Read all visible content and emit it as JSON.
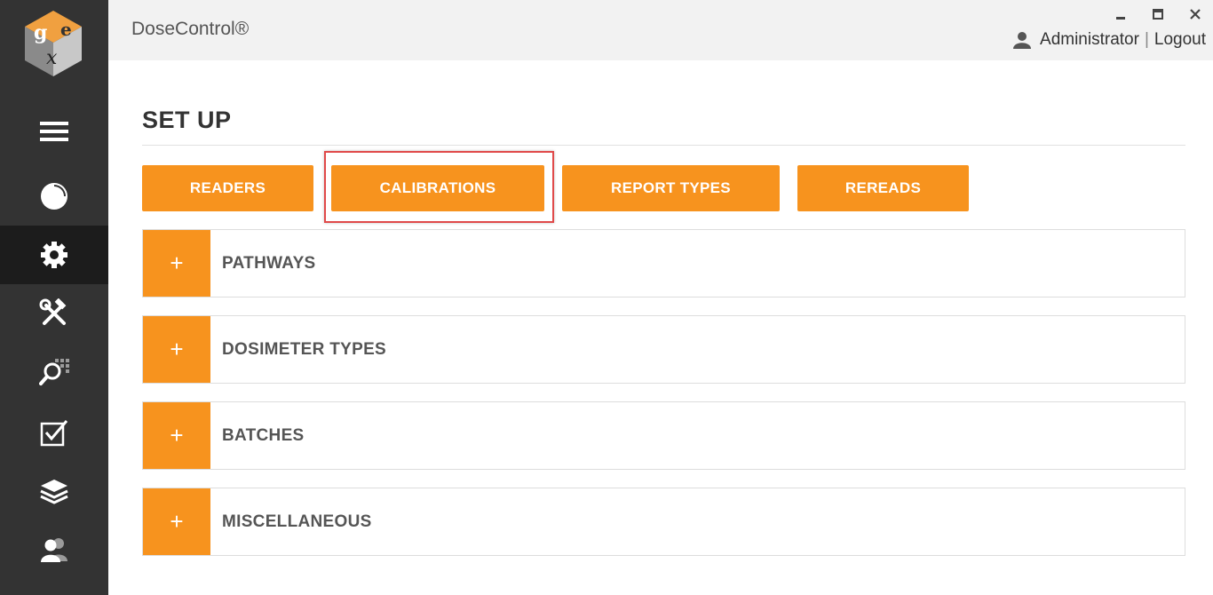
{
  "app": {
    "title": "DoseControl®"
  },
  "user": {
    "name": "Administrator",
    "separator": "|",
    "logout_label": "Logout"
  },
  "page": {
    "title": "SET UP"
  },
  "tabs": [
    {
      "label": "READERS"
    },
    {
      "label": "CALIBRATIONS",
      "highlighted": true
    },
    {
      "label": "REPORT TYPES"
    },
    {
      "label": "REREADS"
    }
  ],
  "panels": [
    {
      "toggle": "+",
      "label": "PATHWAYS"
    },
    {
      "toggle": "+",
      "label": "DOSIMETER TYPES"
    },
    {
      "toggle": "+",
      "label": "BATCHES"
    },
    {
      "toggle": "+",
      "label": "MISCELLANEOUS"
    }
  ],
  "sidebar": {
    "items": [
      {
        "icon": "hamburger-menu-icon"
      },
      {
        "icon": "pie-chart-icon"
      },
      {
        "icon": "gear-icon",
        "active": true
      },
      {
        "icon": "tools-icon"
      },
      {
        "icon": "search-grid-icon"
      },
      {
        "icon": "checkbox-icon"
      },
      {
        "icon": "layers-icon"
      },
      {
        "icon": "users-icon"
      }
    ]
  },
  "colors": {
    "accent": "#f7931e",
    "sidebar": "#333333",
    "sidebar_active": "#1c1c1c",
    "highlight": "#e04a4a"
  }
}
